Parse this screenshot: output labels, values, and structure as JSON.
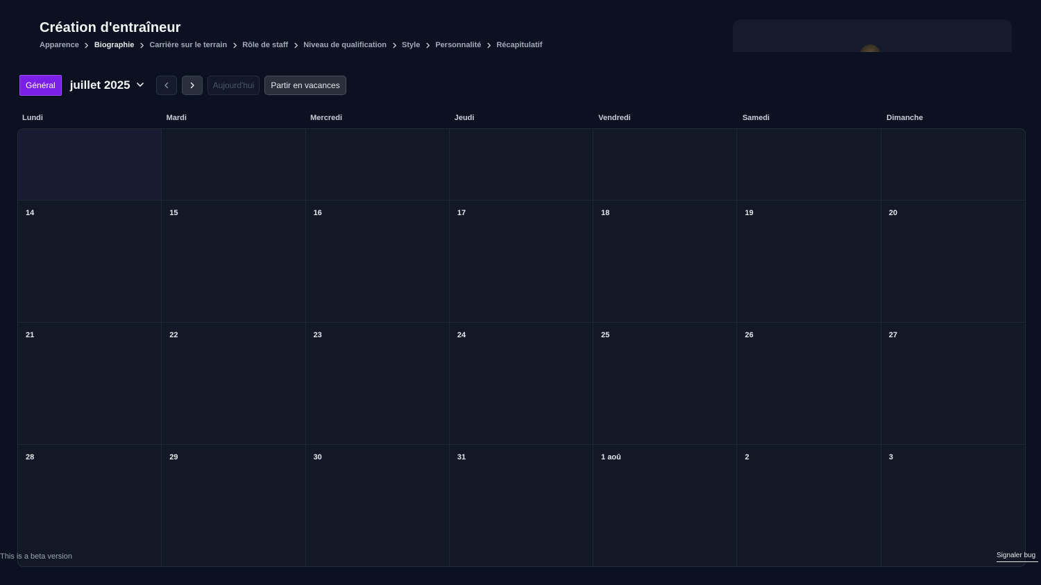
{
  "header": {
    "title": "Création d'entraîneur",
    "breadcrumb": [
      {
        "label": "Apparence",
        "active": false
      },
      {
        "label": "Biographie",
        "active": true
      },
      {
        "label": "Carrière sur le terrain",
        "active": false
      },
      {
        "label": "Rôle de staff",
        "active": false
      },
      {
        "label": "Niveau de qualification",
        "active": false
      },
      {
        "label": "Style",
        "active": false
      },
      {
        "label": "Personnalité",
        "active": false
      },
      {
        "label": "Récapitulatif",
        "active": false
      }
    ]
  },
  "toolbar": {
    "general_label": "Général",
    "month_label": "juillet 2025",
    "today_label": "Aujourd'hui",
    "vacation_label": "Partir en vacances"
  },
  "calendar": {
    "weekdays": [
      "Lundi",
      "Mardi",
      "Mercredi",
      "Jeudi",
      "Vendredi",
      "Samedi",
      "Dimanche"
    ],
    "weeks": [
      [
        "",
        "",
        "",
        "",
        "",
        "",
        ""
      ],
      [
        "14",
        "15",
        "16",
        "17",
        "18",
        "19",
        "20"
      ],
      [
        "21",
        "22",
        "23",
        "24",
        "25",
        "26",
        "27"
      ],
      [
        "28",
        "29",
        "30",
        "31",
        "1 aoû",
        "2",
        "3"
      ]
    ],
    "highlighted_cell": [
      0,
      0
    ]
  },
  "footer": {
    "beta_text": "This is a beta version",
    "report_bug_label": "Signaler bug"
  },
  "colors": {
    "background": "#0b1120",
    "accent": "#7c1fe6",
    "highlight_cell": "#191b33"
  }
}
